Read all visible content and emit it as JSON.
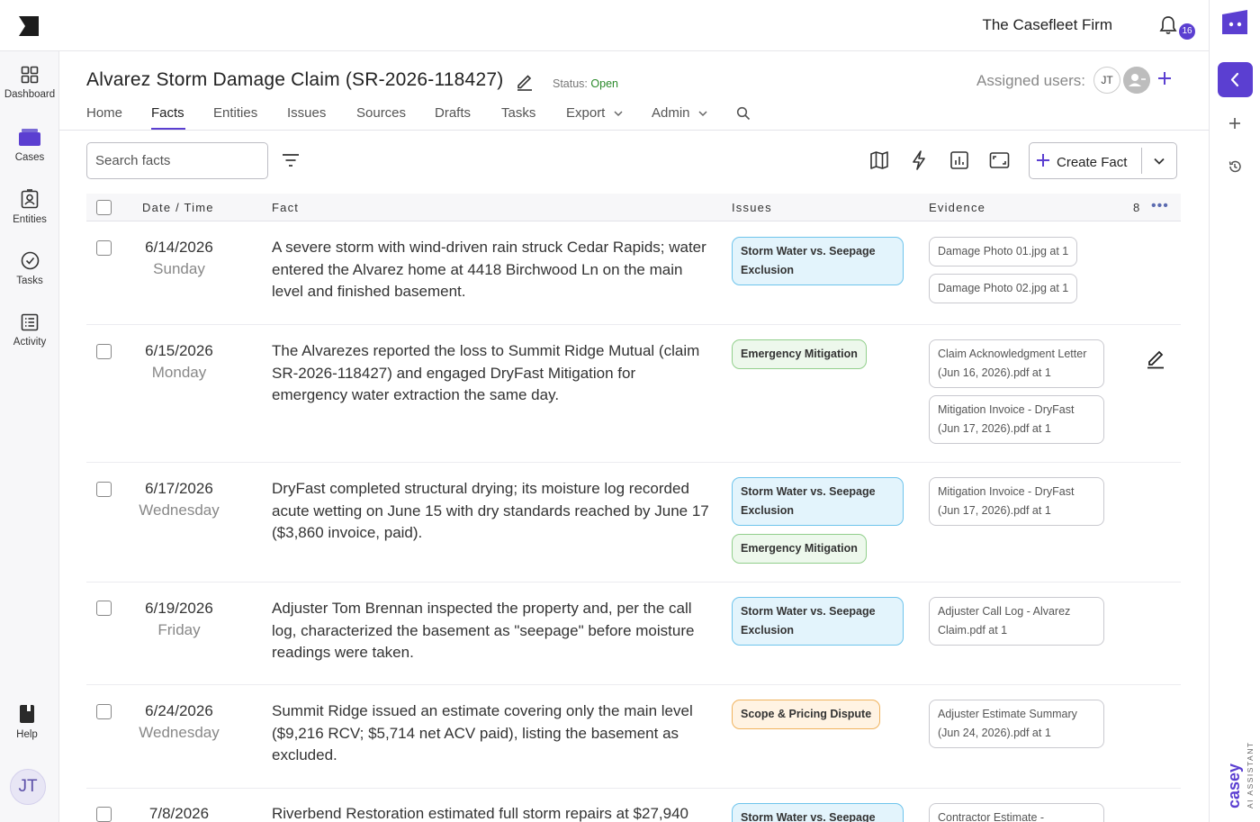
{
  "app": {
    "firm_name": "The Casefleet Firm",
    "notification_count": "16",
    "brand_color": "#5b3fd1"
  },
  "sidebar": {
    "items": [
      {
        "label": "Dashboard",
        "icon": "grid-icon"
      },
      {
        "label": "Cases",
        "icon": "briefcase-icon"
      },
      {
        "label": "Entities",
        "icon": "contact-card-icon"
      },
      {
        "label": "Tasks",
        "icon": "check-circle-icon"
      },
      {
        "label": "Activity",
        "icon": "list-icon"
      }
    ],
    "help_label": "Help",
    "user_initials": "JT"
  },
  "header": {
    "case_title": "Alvarez Storm Damage Claim (SR-2026-118427)",
    "status_label": "Status:",
    "status_value": "Open",
    "assigned_label": "Assigned users:",
    "assigned_users": [
      "JT"
    ]
  },
  "tabs": [
    {
      "label": "Home"
    },
    {
      "label": "Facts",
      "active": true
    },
    {
      "label": "Entities"
    },
    {
      "label": "Issues"
    },
    {
      "label": "Sources"
    },
    {
      "label": "Drafts"
    },
    {
      "label": "Tasks"
    },
    {
      "label": "Export"
    },
    {
      "label": "Admin"
    }
  ],
  "toolbar": {
    "search_placeholder": "Search facts",
    "create_label": "Create Fact"
  },
  "table": {
    "columns": {
      "date": "Date / Time",
      "fact": "Fact",
      "issues": "Issues",
      "evidence": "Evidence"
    },
    "evidence_count": "8",
    "rows": [
      {
        "date": "6/14/2026",
        "day": "Sunday",
        "fact": "A severe storm with wind-driven rain struck Cedar Rapids; water entered the Alvarez home at 4418 Birchwood Ln on the main level and finished basement.",
        "issues": [
          {
            "label": "Storm Water vs. Seepage Exclusion",
            "color": "blue"
          }
        ],
        "evidence": [
          "Damage Photo 01.jpg at 1",
          "Damage Photo 02.jpg at 1"
        ]
      },
      {
        "date": "6/15/2026",
        "day": "Monday",
        "fact": "The Alvarezes reported the loss to Summit Ridge Mutual (claim SR-2026-118427) and engaged DryFast Mitigation for emergency water extraction the same day.",
        "issues": [
          {
            "label": "Emergency Mitigation",
            "color": "green"
          }
        ],
        "evidence": [
          "Claim Acknowledgment Letter (Jun 16, 2026).pdf at 1",
          "Mitigation Invoice - DryFast (Jun 17, 2026).pdf at 1"
        ]
      },
      {
        "date": "6/17/2026",
        "day": "Wednesday",
        "fact": "DryFast completed structural drying; its moisture log recorded acute wetting on June 15 with dry standards reached by June 17 ($3,860 invoice, paid).",
        "issues": [
          {
            "label": "Storm Water vs. Seepage Exclusion",
            "color": "blue"
          },
          {
            "label": "Emergency Mitigation",
            "color": "green"
          }
        ],
        "evidence": [
          "Mitigation Invoice - DryFast (Jun 17, 2026).pdf at 1"
        ]
      },
      {
        "date": "6/19/2026",
        "day": "Friday",
        "fact": "Adjuster Tom Brennan inspected the property and, per the call log, characterized the basement as \"seepage\" before moisture readings were taken.",
        "issues": [
          {
            "label": "Storm Water vs. Seepage Exclusion",
            "color": "blue"
          }
        ],
        "evidence": [
          "Adjuster Call Log - Alvarez Claim.pdf at 1"
        ]
      },
      {
        "date": "6/24/2026",
        "day": "Wednesday",
        "fact": "Summit Ridge issued an estimate covering only the main level ($9,216 RCV; $5,714 net ACV paid), listing the basement as excluded.",
        "issues": [
          {
            "label": "Scope & Pricing Dispute",
            "color": "orange"
          }
        ],
        "evidence": [
          "Adjuster Estimate Summary (Jun 24, 2026).pdf at 1"
        ]
      },
      {
        "date": "7/8/2026",
        "day": "",
        "fact": "Riverbend Restoration estimated full storm repairs at $27,940",
        "issues": [
          {
            "label": "Storm Water vs. Seepage",
            "color": "blue"
          }
        ],
        "evidence": [
          "Contractor Estimate -"
        ]
      }
    ]
  },
  "assistant": {
    "name": "casey",
    "tagline": "AI ASSISTANT"
  }
}
